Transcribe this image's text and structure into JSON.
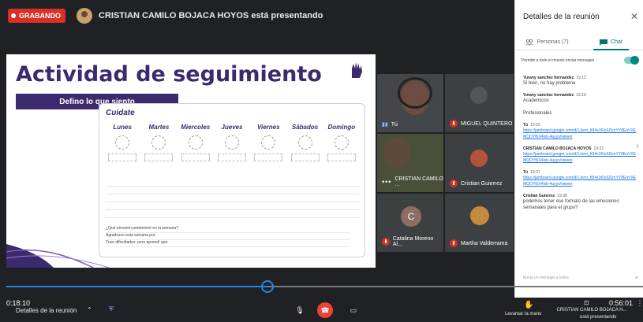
{
  "recording": {
    "label": "GRABANDO"
  },
  "presenter": {
    "text": "CRISTIAN CAMILO BOJACA HOYOS está presentando"
  },
  "slide": {
    "title": "Actividad de seguimiento",
    "banner": "Defino lo que siento",
    "logo_text": "Cuidate",
    "days": [
      "Lunes",
      "Martes",
      "Miercoles",
      "Jueves",
      "Viernes",
      "Sábados",
      "Domingo"
    ],
    "questions": [
      "¿Qué emoción predominó en la semana?",
      "Agradezco esta semana por:",
      "Tuve dificultades, pero aprendí que:"
    ]
  },
  "participants": {
    "you": "Tú",
    "miguel": "MIGUEL QUINTERO",
    "cristian_camilo": "CRISTIAN CAMILO ...",
    "cristian_guierrez": "Cristian Guierrez",
    "catalina_initial": "C",
    "catalina": "Catalina Moreno Al...",
    "martha": "Martha Valderrama"
  },
  "panel": {
    "title": "Detalles de la reunión",
    "tab_people": "Personas (7)",
    "tab_chat": "Chat",
    "allow_label": "Permitir a todo el mundo enviar mensajes",
    "messages": [
      {
        "author": "Yurany sanchez hernandez",
        "time": "19:13",
        "text": "Si bien, no hay problema"
      },
      {
        "author": "Yurany sanchez hernandez",
        "time": "19:19",
        "text": "Academicos"
      },
      {
        "author": "",
        "time": "",
        "text": "Profesionales"
      },
      {
        "author": "Tú",
        "time": "19:20",
        "link": "https://jamboard.google.com/d/1Jsmr_lt94x1Klc6ZlznYY8EoVXEMQOYt6X4lxb-4uyys/viewer"
      },
      {
        "author": "CRISTIAN CAMILO BOJACA HOYOS",
        "time": "19:32",
        "link": "https://jamboard.google.com/d/1Jsmr_lt94x1Klc6ZlznYY8EoVXEMQOYt6X4lxb-4uyys/viewer"
      },
      {
        "author": "Tú",
        "time": "19:37",
        "link": "https://jamboard.google.com/d/1Jsmr_lt94x1Klc6ZlznYY8EoVXEMQOYt6X4lxb-4uyys/viewer"
      },
      {
        "author": "Cristian Guierrez",
        "time": "19:38",
        "text": "podemos tener ese formato de las emociones semanales para el grupo?"
      }
    ],
    "input_placeholder": "Envía un mensaje a todos"
  },
  "player": {
    "progress": 0.41,
    "elapsed": "0:18:10",
    "remaining": "0:56:01"
  },
  "bottom": {
    "details": "Detalles de la reunión",
    "raise_hand": "Levantar la mano",
    "presenting_name": "CRISTIAN CAMILO BOJACA H...",
    "presenting_sub": "está presentando"
  },
  "colors": {
    "record": "#d93025",
    "accent": "#00796b",
    "slide_purple": "#3b2a6d",
    "progress": "#1e88e5"
  }
}
